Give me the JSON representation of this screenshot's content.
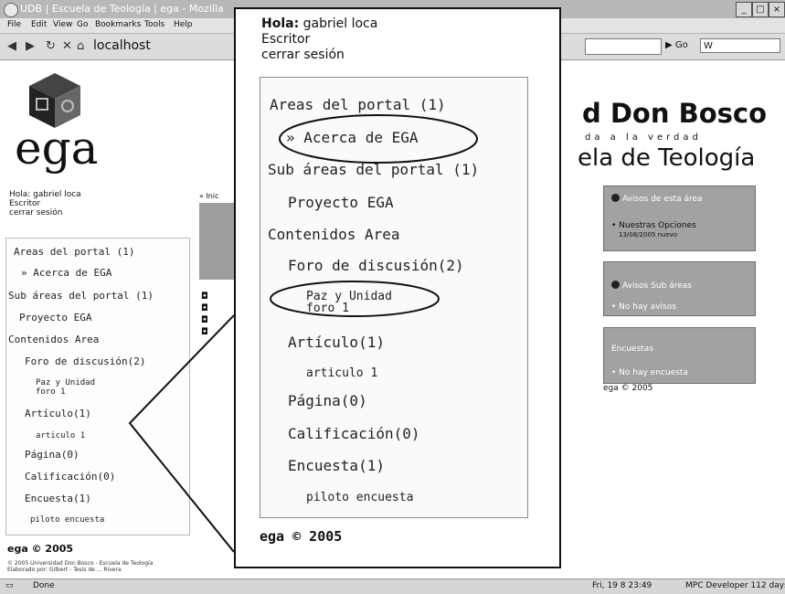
{
  "browser": {
    "title": "UDB | Escuela de Teología | ega - Mozilla",
    "menu": [
      "File",
      "Edit",
      "View",
      "Go",
      "Bookmarks",
      "Tools",
      "Help"
    ],
    "location": "localhost",
    "go_label": "Go",
    "search_value": "W",
    "status_text": "Done",
    "clock_text": "Fri, 19 8 23:49",
    "status_right": "MPC Developer 112 days"
  },
  "left": {
    "logo_text": "ega",
    "user_greeting": "Hola: gabriel loca",
    "user_role": "Escritor",
    "logout": "cerrar sesión",
    "nav": [
      "Areas del portal (1)",
      "» Acerca de EGA",
      "Sub áreas del portal (1)",
      "Proyecto EGA",
      "Contenidos Area",
      "Foro de discusión(2)",
      "Paz y Unidad",
      "foro 1",
      "Artículo(1)",
      "articulo 1",
      "Página(0)",
      "Calificación(0)",
      "Encuesta(1)",
      "piloto encuesta"
    ],
    "footer": "ega © 2005",
    "small_line1": "© 2005 Universidad Don Bosco - Escuela de Teología",
    "small_line2": "Elaborado por: Gilbert - Tesis de ... Rivera"
  },
  "middle": {
    "crumb": "» Inic"
  },
  "header": {
    "university": "d Don Bosco",
    "motto": "da a la verdad",
    "school": "ela de Teología"
  },
  "right": {
    "box1_title": "Avisos de esta área",
    "box1_item": "• Nuestras Opciones",
    "box1_meta": "13/08/2005 nuevo",
    "box2_title": "Avisos Sub áreas",
    "box2_item": "• No hay avisos",
    "box3_title": "Encuestas",
    "box3_item": "• No hay encuesta",
    "footer": "ega © 2005"
  },
  "zoom": {
    "greeting_label": "Hola:",
    "greeting_name": "gabriel loca",
    "role": "Escritor",
    "logout": "cerrar sesión",
    "nav": [
      "Areas del portal (1)",
      "» Acerca de EGA",
      "Sub áreas del portal (1)",
      "Proyecto EGA",
      "Contenidos Area",
      "Foro de discusión(2)",
      "Paz y Unidad",
      "foro 1",
      "Artículo(1)",
      "articulo 1",
      "Página(0)",
      "Calificación(0)",
      "Encuesta(1)",
      "piloto encuesta"
    ],
    "footer": "ega © 2005"
  }
}
